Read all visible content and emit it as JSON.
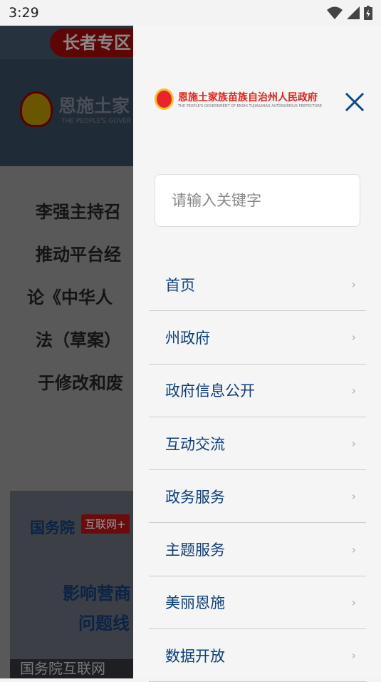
{
  "status": {
    "time": "3:29",
    "icons": [
      "wifi-icon",
      "signal-icon",
      "battery-icon"
    ]
  },
  "background": {
    "elder_button": "长者专区",
    "header_title": "恩施土家",
    "header_subtitle": "THE PEOPLE'S GOVER",
    "news_lines": [
      "李强主持召",
      "推动平台经",
      "论《中华人",
      "法（草案）",
      "于修改和废"
    ],
    "card": {
      "org": "国务院",
      "tag": "互联网+",
      "line1": "影响营商",
      "line2": "问题线",
      "footer": "国务院互联网"
    }
  },
  "drawer": {
    "logo": {
      "title": "恩施土家族苗族自治州人民政府",
      "subtitle": "THE PEOPLE'S GOVERNMENT OF ENSHI TUJIA&MIAO AUTONOMOUS PREFECTURE"
    },
    "search": {
      "placeholder": "请输入关键字",
      "button_color": "#5090d0"
    },
    "menu": [
      {
        "label": "首页"
      },
      {
        "label": "州政府"
      },
      {
        "label": "政府信息公开"
      },
      {
        "label": "互动交流"
      },
      {
        "label": "政务服务"
      },
      {
        "label": "主题服务"
      },
      {
        "label": "美丽恩施"
      },
      {
        "label": "数据开放"
      }
    ],
    "accent": "#0c3f7c"
  }
}
